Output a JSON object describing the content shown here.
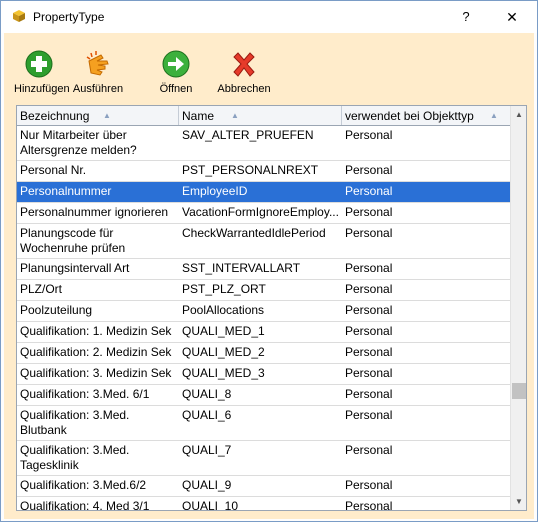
{
  "window": {
    "title": "PropertyType",
    "help": "?",
    "close": "✕"
  },
  "toolbar": {
    "items": [
      {
        "label": "Hinzufügen",
        "icon": "add-icon"
      },
      {
        "label": "Ausführen",
        "icon": "execute-hand-icon"
      },
      {
        "label": "Öffnen",
        "icon": "open-arrow-icon"
      },
      {
        "label": "Abbrechen",
        "icon": "cancel-x-icon"
      }
    ]
  },
  "grid": {
    "columns": [
      "Bezeichnung",
      "Name",
      "verwendet bei Objekttyp"
    ],
    "rows": [
      {
        "bezeichnung": "Nur Mitarbeiter über Altersgrenze melden?",
        "name": "SAV_ALTER_PRUEFEN",
        "typ": "Personal"
      },
      {
        "bezeichnung": "Personal Nr.",
        "name": "PST_PERSONALNREXT",
        "typ": "Personal"
      },
      {
        "bezeichnung": "Personalnummer",
        "name": "EmployeeID",
        "typ": "Personal",
        "selected": true
      },
      {
        "bezeichnung": "Personalnummer ignorieren",
        "name": "VacationFormIgnoreEmploy...",
        "typ": "Personal"
      },
      {
        "bezeichnung": "Planungscode für Wochenruhe prüfen",
        "name": "CheckWarrantedIdlePeriod",
        "typ": "Personal"
      },
      {
        "bezeichnung": "Planungsintervall Art",
        "name": "SST_INTERVALLART",
        "typ": "Personal"
      },
      {
        "bezeichnung": "PLZ/Ort",
        "name": "PST_PLZ_ORT",
        "typ": "Personal"
      },
      {
        "bezeichnung": "Poolzuteilung",
        "name": "PoolAllocations",
        "typ": "Personal"
      },
      {
        "bezeichnung": "Qualifikation: 1. Medizin Sek",
        "name": "QUALI_MED_1",
        "typ": "Personal"
      },
      {
        "bezeichnung": "Qualifikation: 2. Medizin Sek",
        "name": "QUALI_MED_2",
        "typ": "Personal"
      },
      {
        "bezeichnung": "Qualifikation: 3. Medizin Sek",
        "name": "QUALI_MED_3",
        "typ": "Personal"
      },
      {
        "bezeichnung": "Qualifikation: 3.Med. 6/1",
        "name": "QUALI_8",
        "typ": "Personal"
      },
      {
        "bezeichnung": "Qualifikation: 3.Med. Blutbank",
        "name": "QUALI_6",
        "typ": "Personal"
      },
      {
        "bezeichnung": "Qualifikation: 3.Med. Tagesklinik",
        "name": "QUALI_7",
        "typ": "Personal"
      },
      {
        "bezeichnung": "Qualifikation: 3.Med.6/2",
        "name": "QUALI_9",
        "typ": "Personal"
      },
      {
        "bezeichnung": "Qualifikation: 4. Med 3/1",
        "name": "QUALI_10",
        "typ": "Personal"
      }
    ]
  },
  "colors": {
    "toolbar_bg": "#ffeccb",
    "selection": "#2a70d6"
  }
}
